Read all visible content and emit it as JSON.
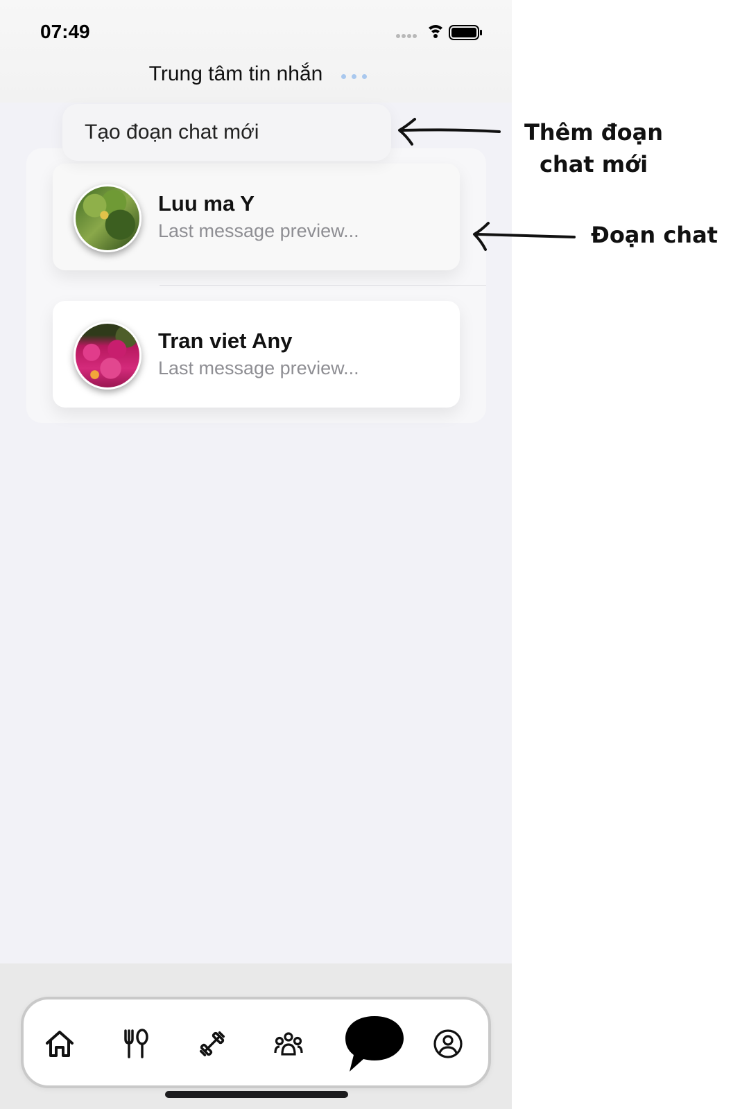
{
  "status_bar": {
    "time": "07:49"
  },
  "nav": {
    "title": "Trung tâm tin nhắn"
  },
  "menu": {
    "create_chat_label": "Tạo đoạn chat mới"
  },
  "chats": [
    {
      "name": "Luu ma Y",
      "preview": "Last message preview..."
    },
    {
      "name": "Tran viet Any",
      "preview": "Last message preview..."
    }
  ],
  "tabs": [
    "home-icon",
    "restaurant-icon",
    "dumbbell-icon",
    "group-icon",
    "chat-bubble-icon",
    "profile-icon"
  ],
  "annotations": {
    "new_chat": "Thêm đoạn chat mới",
    "chat": "Đoạn chat"
  },
  "colors": {
    "accent_dots": "#a9c8ee",
    "background": "#f2f2f7"
  }
}
